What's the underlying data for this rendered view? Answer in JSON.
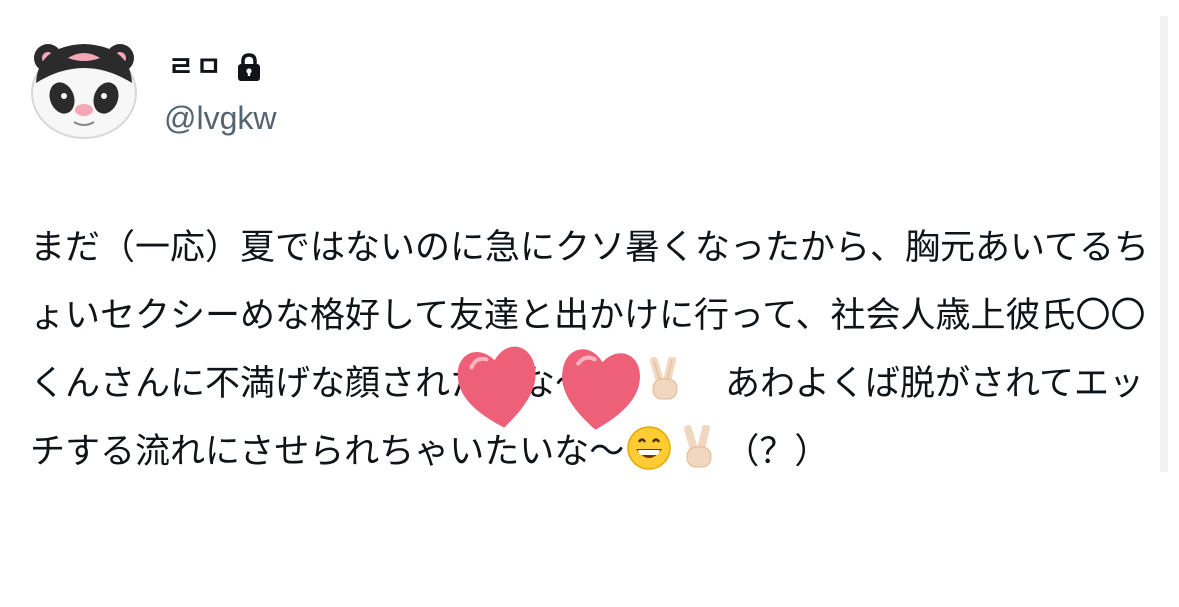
{
  "tweet": {
    "author": {
      "display_name": "ㄹㅁ",
      "handle": "@lvgkw",
      "avatar_icon": "panda-avatar",
      "protected_icon": "lock-icon"
    },
    "text_segments": [
      "まだ（一応）夏ではないのに急にクソ暑くなったから、胸元あいてるちょいセクシーめな格好して友達と出かけに行って、社会人歳上彼氏〇〇くんさんに不満げな顔されたいな〜",
      "　あわよくば脱がされてエッチする流れにさせられちゃいたいな〜",
      "（？）"
    ],
    "emojis": [
      "grinning-face-emoji",
      "victory-hand-emoji"
    ],
    "stickers": [
      "heart-sticker",
      "heart-sticker"
    ],
    "colors": {
      "text": "#0f1419",
      "secondary_text": "#536471",
      "heart": "#f0647a"
    }
  }
}
